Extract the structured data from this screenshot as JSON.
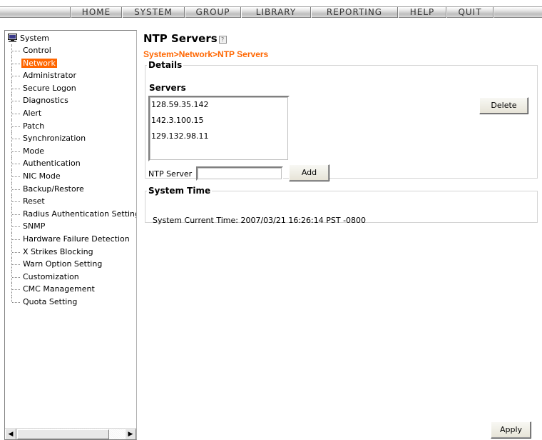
{
  "menu": {
    "items": [
      "HOME",
      "SYSTEM",
      "GROUP",
      "LIBRARY",
      "REPORTING",
      "HELP",
      "QUIT"
    ]
  },
  "sidebar": {
    "root_label": "System",
    "selected_item": "Network",
    "items": [
      "Control",
      "Network",
      "Administrator",
      "Secure Logon",
      "Diagnostics",
      "Alert",
      "Patch",
      "Synchronization",
      "Mode",
      "Authentication",
      "NIC Mode",
      "Backup/Restore",
      "Reset",
      "Radius Authentication Setting",
      "SNMP",
      "Hardware Failure Detection",
      "X Strikes Blocking",
      "Warn Option Setting",
      "Customization",
      "CMC Management",
      "Quota Setting"
    ]
  },
  "page": {
    "title": "NTP Servers",
    "breadcrumb": "System>Network>NTP Servers"
  },
  "details": {
    "legend": "Details",
    "servers_label": "Servers",
    "servers": [
      "128.59.35.142",
      "142.3.100.15",
      "129.132.98.11"
    ],
    "delete_label": "Delete",
    "ntp_server_label": "NTP Server",
    "ntp_server_value": "",
    "add_label": "Add"
  },
  "system_time": {
    "legend": "System Time",
    "current_time_label": "System Current Time:",
    "current_time_value": "2007/03/21 16:26:14 PST -0800"
  },
  "footer": {
    "apply_label": "Apply"
  },
  "colors": {
    "accent": "#ff6600",
    "selection_text": "#ffffff"
  }
}
